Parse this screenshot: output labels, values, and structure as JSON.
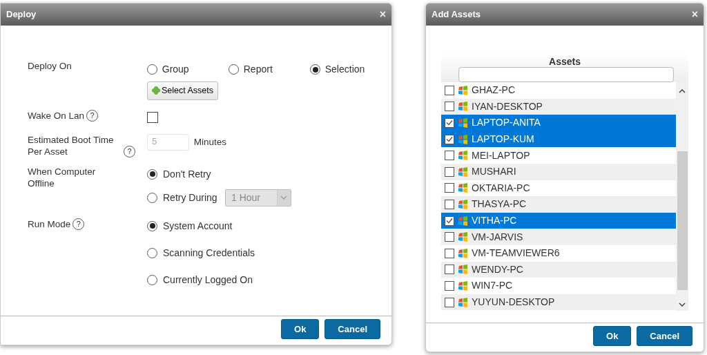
{
  "deploy_dialog": {
    "title": "Deploy",
    "close": "×",
    "fields": [
      {
        "kind": "radios",
        "label": "Deploy On",
        "options": [
          {
            "label": "Group",
            "selected": false
          },
          {
            "label": "Report",
            "selected": false
          },
          {
            "label": "Selection",
            "selected": true
          }
        ],
        "button": "Select Assets"
      },
      {
        "kind": "checkbox",
        "label": "Wake On Lan",
        "help": "?",
        "checked": false
      },
      {
        "kind": "number",
        "label": "Estimated Boot Time Per Asset",
        "help": "?",
        "value": "5",
        "unit": "Minutes"
      },
      {
        "kind": "stack",
        "label": "When Computer Offline",
        "options": [
          {
            "label": "Don't Retry",
            "selected": true
          },
          {
            "label": "Retry During",
            "selected": false,
            "select": "1 Hour"
          }
        ]
      },
      {
        "kind": "stack",
        "label": "Run Mode",
        "help": "?",
        "options": [
          {
            "label": "System Account",
            "selected": true
          },
          {
            "label": "Scanning Credentials",
            "selected": false
          },
          {
            "label": "Currently Logged On",
            "selected": false
          }
        ]
      }
    ],
    "buttons": [
      "Ok",
      "Cancel"
    ]
  },
  "add_assets_dialog": {
    "title": "Add Assets",
    "close": "×",
    "column": "Assets",
    "rows": [
      {
        "name": "GHAZ-PC",
        "checked": false,
        "selected": false
      },
      {
        "name": "IYAN-DESKTOP",
        "checked": false,
        "selected": false
      },
      {
        "name": "LAPTOP-ANITA",
        "checked": true,
        "selected": true
      },
      {
        "name": "LAPTOP-KUM",
        "checked": true,
        "selected": true
      },
      {
        "name": "MEI-LAPTOP",
        "checked": false,
        "selected": false
      },
      {
        "name": "MUSHARI",
        "checked": false,
        "selected": false
      },
      {
        "name": "OKTARIA-PC",
        "checked": false,
        "selected": false
      },
      {
        "name": "THASYA-PC",
        "checked": false,
        "selected": false
      },
      {
        "name": "VITHA-PC",
        "checked": true,
        "selected": true
      },
      {
        "name": "VM-JARVIS",
        "checked": false,
        "selected": false
      },
      {
        "name": "VM-TEAMVIEWER6",
        "checked": false,
        "selected": false
      },
      {
        "name": "WENDY-PC",
        "checked": false,
        "selected": false
      },
      {
        "name": "WIN7-PC",
        "checked": false,
        "selected": false
      },
      {
        "name": "YUYUN-DESKTOP",
        "checked": false,
        "selected": false
      }
    ],
    "buttons": [
      "Ok",
      "Cancel"
    ]
  }
}
